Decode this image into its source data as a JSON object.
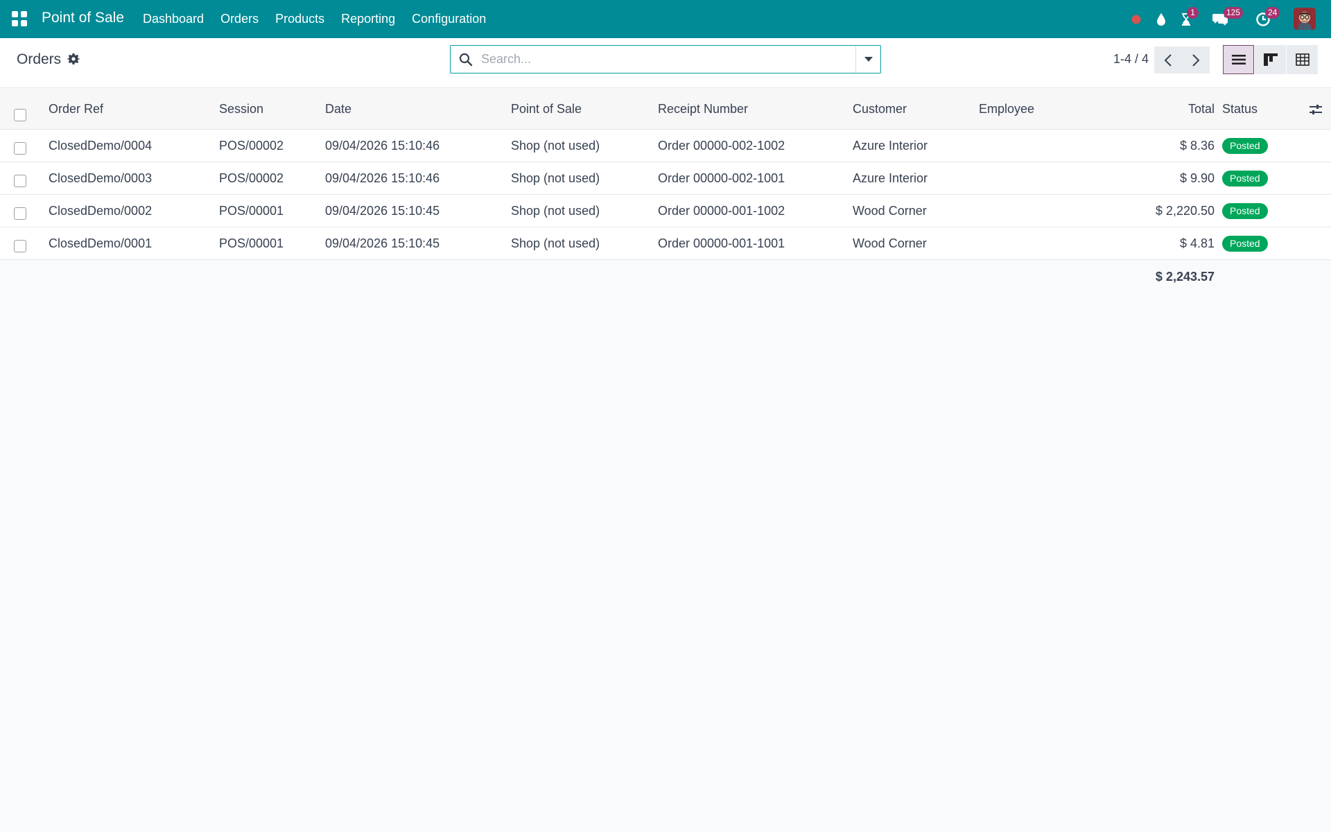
{
  "navbar": {
    "app_name": "Point of Sale",
    "menu": [
      "Dashboard",
      "Orders",
      "Products",
      "Reporting",
      "Configuration"
    ],
    "badges": {
      "activities": "1",
      "messages": "125",
      "timesheet": "24"
    },
    "colors": {
      "bar": "#008b96",
      "badge": "#a7336e",
      "recording_dot": "#d9534f"
    }
  },
  "control": {
    "title": "Orders",
    "search_placeholder": "Search...",
    "pager": "1-4 / 4"
  },
  "table": {
    "columns": {
      "order_ref": "Order Ref",
      "session": "Session",
      "date": "Date",
      "pos": "Point of Sale",
      "receipt": "Receipt Number",
      "customer": "Customer",
      "employee": "Employee",
      "total": "Total",
      "status": "Status"
    },
    "rows": [
      {
        "order_ref": "ClosedDemo/0004",
        "session": "POS/00002",
        "date": "09/04/2026 15:10:46",
        "pos": "Shop (not used)",
        "receipt": "Order 00000-002-1002",
        "customer": "Azure Interior",
        "employee": "",
        "total": "$ 8.36",
        "status": "Posted"
      },
      {
        "order_ref": "ClosedDemo/0003",
        "session": "POS/00002",
        "date": "09/04/2026 15:10:46",
        "pos": "Shop (not used)",
        "receipt": "Order 00000-002-1001",
        "customer": "Azure Interior",
        "employee": "",
        "total": "$ 9.90",
        "status": "Posted"
      },
      {
        "order_ref": "ClosedDemo/0002",
        "session": "POS/00001",
        "date": "09/04/2026 15:10:45",
        "pos": "Shop (not used)",
        "receipt": "Order 00000-001-1002",
        "customer": "Wood Corner",
        "employee": "",
        "total": "$ 2,220.50",
        "status": "Posted"
      },
      {
        "order_ref": "ClosedDemo/0001",
        "session": "POS/00001",
        "date": "09/04/2026 15:10:45",
        "pos": "Shop (not used)",
        "receipt": "Order 00000-001-1001",
        "customer": "Wood Corner",
        "employee": "",
        "total": "$ 4.81",
        "status": "Posted"
      }
    ],
    "grand_total": "$ 2,243.57",
    "status_color": "#00a65a"
  }
}
